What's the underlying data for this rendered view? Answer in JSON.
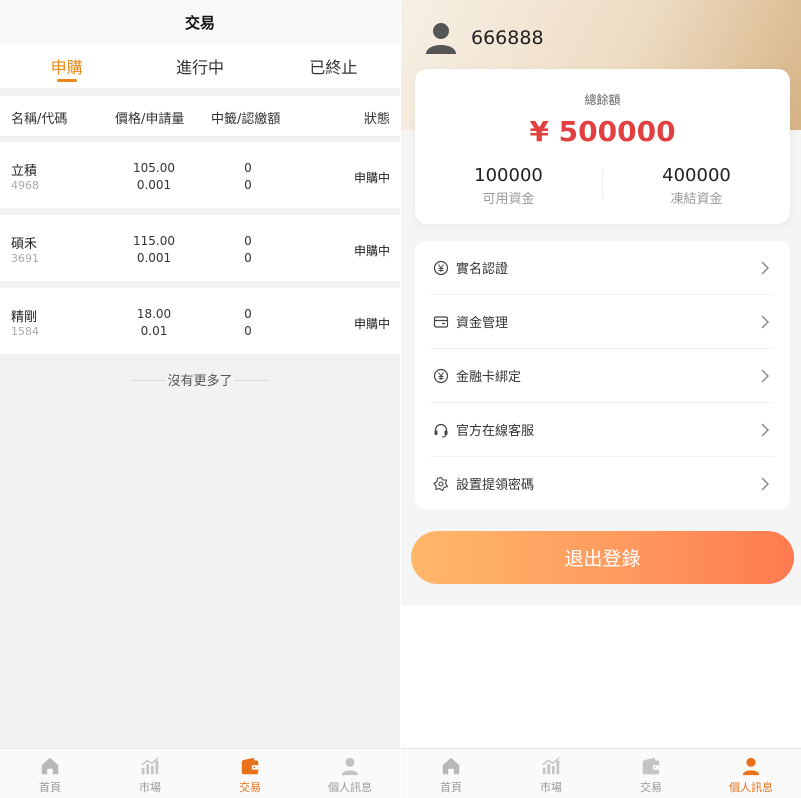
{
  "left": {
    "title": "交易",
    "tabs": [
      {
        "label": "申購",
        "active": true
      },
      {
        "label": "進行中",
        "active": false
      },
      {
        "label": "已終止",
        "active": false
      }
    ],
    "columns": [
      "名稱/代碼",
      "價格/申請量",
      "中籤/認繳額",
      "狀態"
    ],
    "rows": [
      {
        "name": "立積",
        "code": "4968",
        "price": "105.00",
        "qty": "0.001",
        "won": "0",
        "paid": "0",
        "status": "申購中"
      },
      {
        "name": "碩禾",
        "code": "3691",
        "price": "115.00",
        "qty": "0.001",
        "won": "0",
        "paid": "0",
        "status": "申購中"
      },
      {
        "name": "精剛",
        "code": "1584",
        "price": "18.00",
        "qty": "0.01",
        "won": "0",
        "paid": "0",
        "status": "申購中"
      }
    ],
    "no_more": "沒有更多了"
  },
  "tabbar": {
    "items": [
      {
        "label": "首頁",
        "icon": "home-icon"
      },
      {
        "label": "市場",
        "icon": "chart-icon"
      },
      {
        "label": "交易",
        "icon": "wallet-icon"
      },
      {
        "label": "個人訊息",
        "icon": "person-icon"
      }
    ],
    "active_color": "#e8711a",
    "inactive_color": "#999999"
  },
  "right": {
    "username": "666888",
    "balance_title": "總餘額",
    "balance_amount": "¥ 500000",
    "available_value": "100000",
    "available_label": "可用資金",
    "frozen_value": "400000",
    "frozen_label": "凍結資金",
    "menu": [
      {
        "label": "實名認證",
        "icon": "verify-icon"
      },
      {
        "label": "資金管理",
        "icon": "wallet-card-icon"
      },
      {
        "label": "金融卡綁定",
        "icon": "yen-circle-icon"
      },
      {
        "label": "官方在線客服",
        "icon": "headset-icon"
      },
      {
        "label": "設置提領密碼",
        "icon": "flower-settings-icon"
      }
    ],
    "logout_label": "退出登錄",
    "accent_color": "#e24040"
  }
}
